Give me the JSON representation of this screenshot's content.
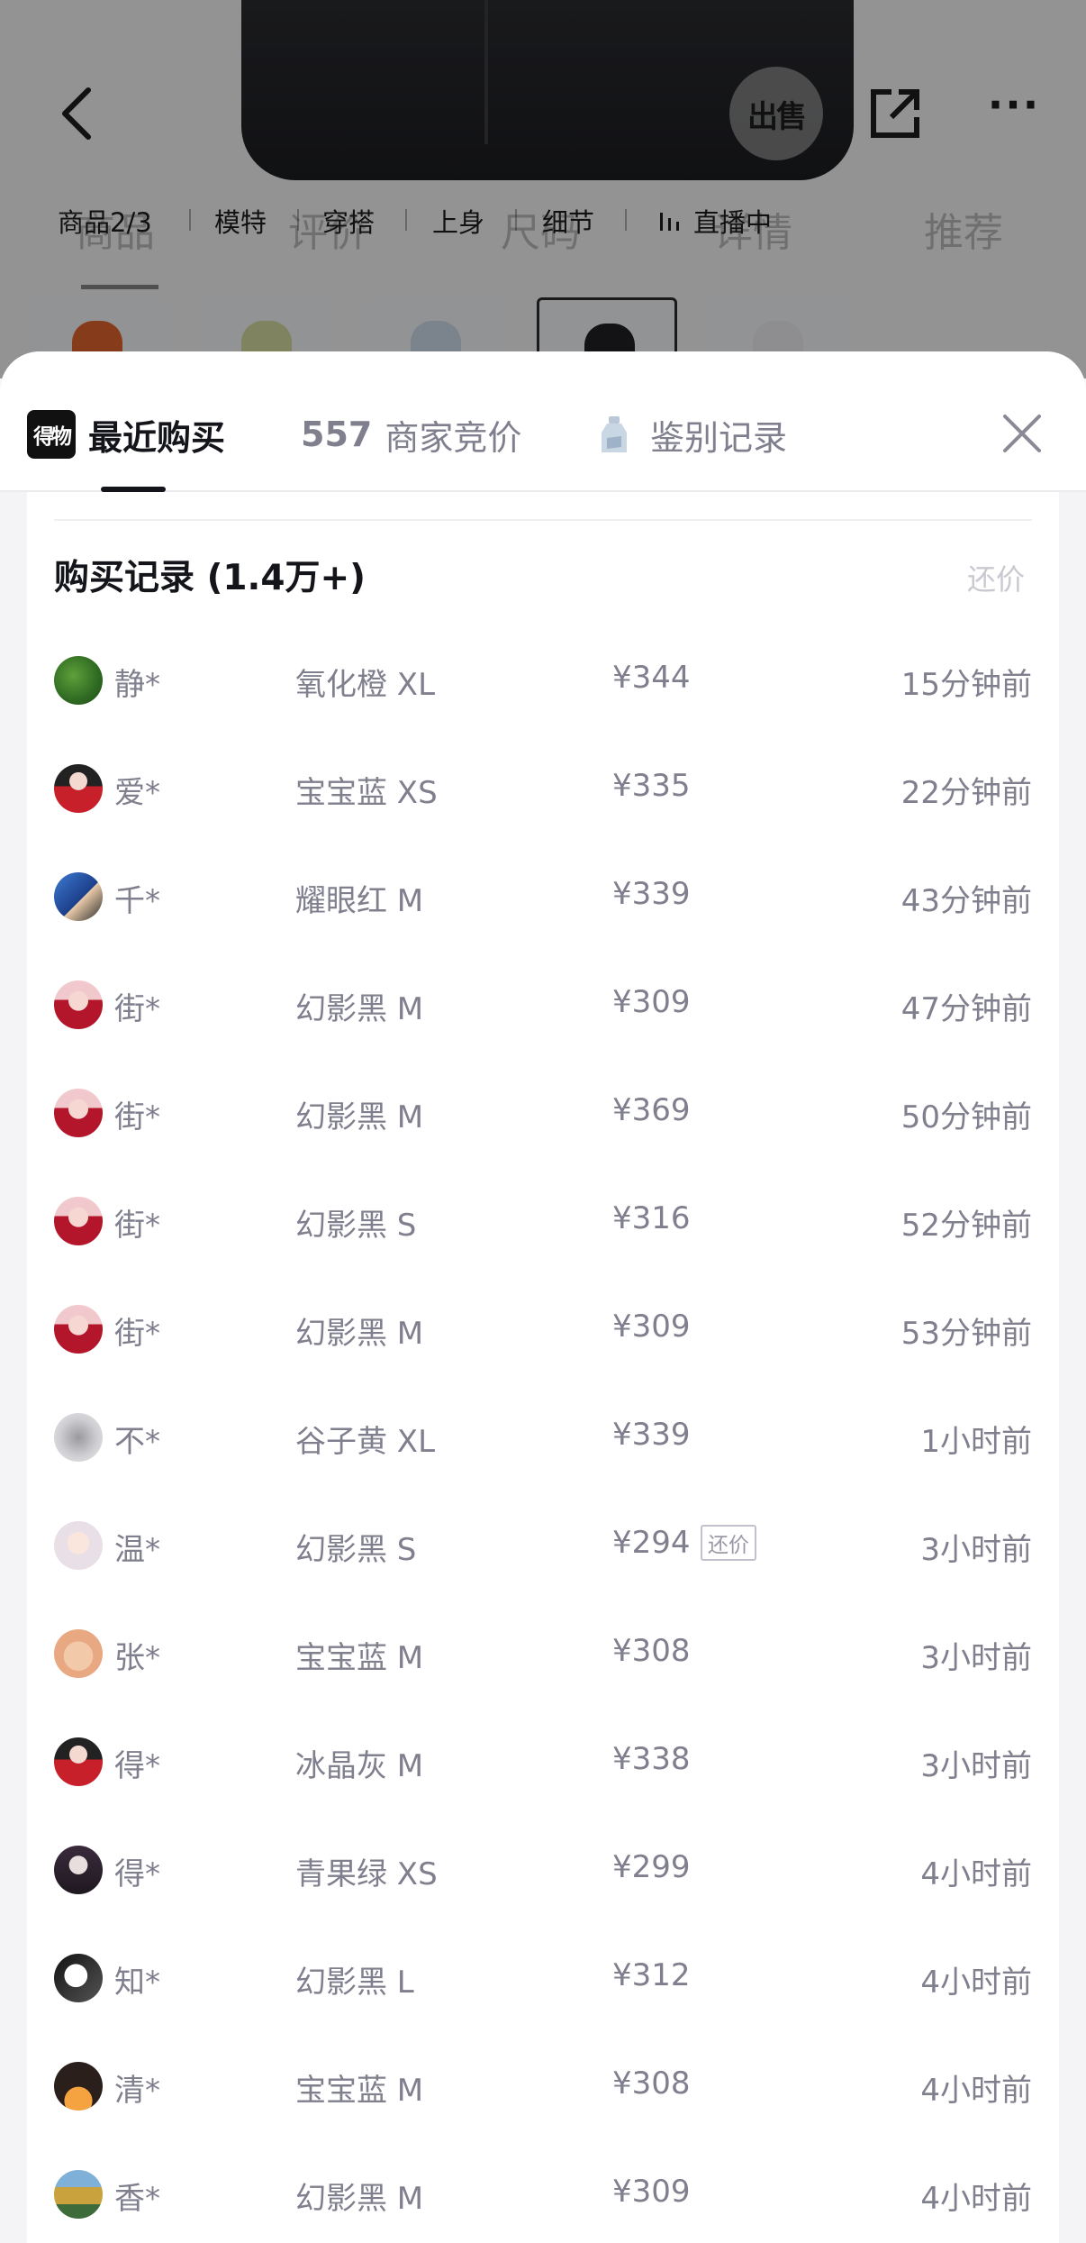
{
  "background": {
    "anchors": [
      "商品2/3",
      "模特",
      "穿搭",
      "上身",
      "细节",
      "直播中"
    ],
    "ghost_tabs": [
      "商品",
      "评价",
      "尺码",
      "详情",
      "推荐"
    ],
    "sell_label": "出售",
    "thumb_colors": [
      "#d9622a",
      "#cfd39a",
      "#c7d3e3",
      "#1f1f22",
      "#e6e6e8"
    ]
  },
  "sheet": {
    "tabs": {
      "recent": {
        "logo": "得物",
        "label": "最近购买"
      },
      "bids": {
        "count": "557",
        "label": "商家竞价"
      },
      "auth": {
        "label": "鉴别记录"
      }
    },
    "records": {
      "title": "购买记录 (1.4万+)",
      "action": "还价",
      "haggle_badge": "还价",
      "rows": [
        {
          "user": "静*",
          "variant": "氧化橙 XL",
          "price": "¥344",
          "time": "15分钟前",
          "avatar": "tree"
        },
        {
          "user": "爱*",
          "variant": "宝宝蓝 XS",
          "price": "¥335",
          "time": "22分钟前",
          "avatar": "red-anime"
        },
        {
          "user": "千*",
          "variant": "耀眼红 M",
          "price": "¥339",
          "time": "43分钟前",
          "avatar": "blue-person"
        },
        {
          "user": "街*",
          "variant": "幻影黑 M",
          "price": "¥309",
          "time": "47分钟前",
          "avatar": "pink-girl"
        },
        {
          "user": "街*",
          "variant": "幻影黑 M",
          "price": "¥369",
          "time": "50分钟前",
          "avatar": "pink-girl"
        },
        {
          "user": "街*",
          "variant": "幻影黑 S",
          "price": "¥316",
          "time": "52分钟前",
          "avatar": "pink-girl"
        },
        {
          "user": "街*",
          "variant": "幻影黑 M",
          "price": "¥309",
          "time": "53分钟前",
          "avatar": "pink-girl"
        },
        {
          "user": "不*",
          "variant": "谷子黄 XL",
          "price": "¥339",
          "time": "1小时前",
          "avatar": "gray-blur"
        },
        {
          "user": "温*",
          "variant": "幻影黑 S",
          "price": "¥294",
          "time": "3小时前",
          "avatar": "light-anime",
          "haggle": true
        },
        {
          "user": "张*",
          "variant": "宝宝蓝 M",
          "price": "¥308",
          "time": "3小时前",
          "avatar": "bear"
        },
        {
          "user": "得*",
          "variant": "冰晶灰 M",
          "price": "¥338",
          "time": "3小时前",
          "avatar": "red-anime"
        },
        {
          "user": "得*",
          "variant": "青果绿 XS",
          "price": "¥299",
          "time": "4小时前",
          "avatar": "dark-anime"
        },
        {
          "user": "知*",
          "variant": "幻影黑 L",
          "price": "¥312",
          "time": "4小时前",
          "avatar": "bw-anime"
        },
        {
          "user": "清*",
          "variant": "宝宝蓝 M",
          "price": "¥308",
          "time": "4小时前",
          "avatar": "sunset"
        },
        {
          "user": "香*",
          "variant": "幻影黑 M",
          "price": "¥309",
          "time": "4小时前",
          "avatar": "forest"
        }
      ]
    }
  }
}
